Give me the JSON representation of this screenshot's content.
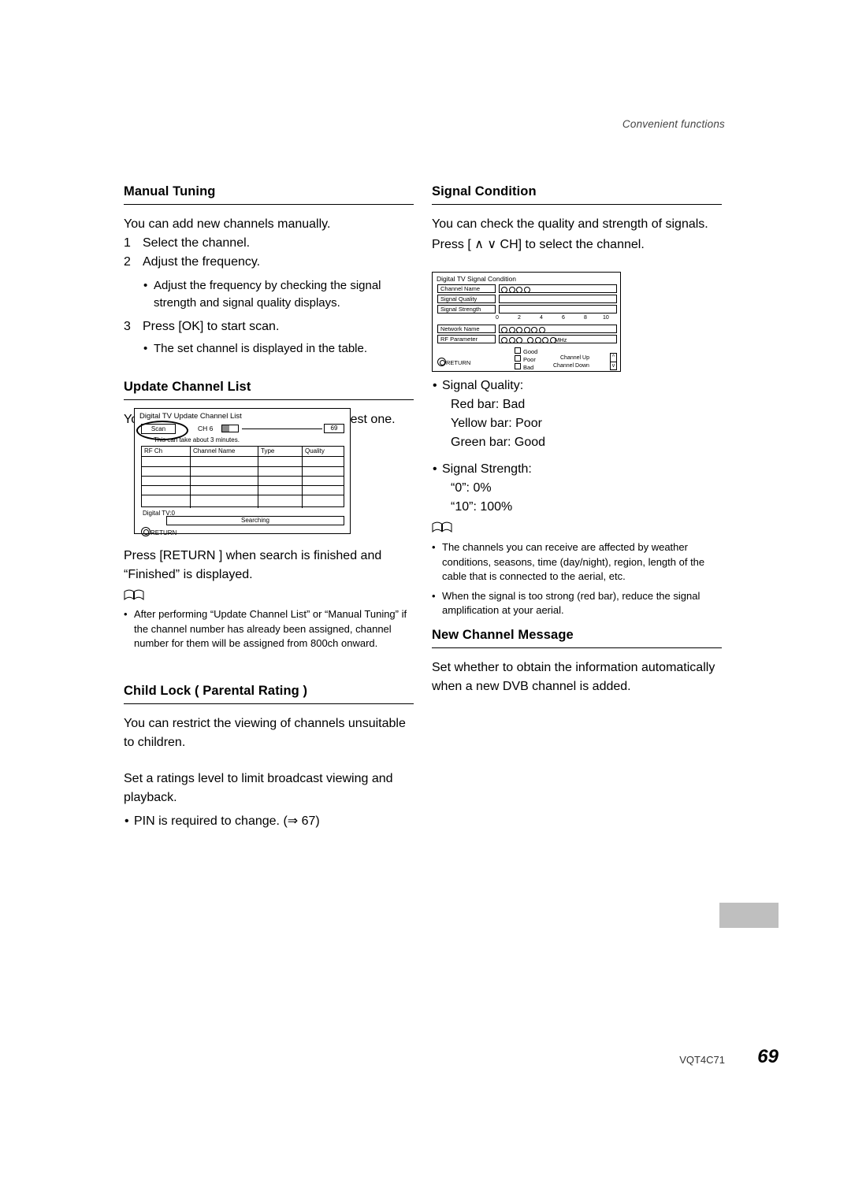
{
  "header": {
    "running_head": "Convenient functions"
  },
  "left": {
    "manual_tuning": {
      "title": "Manual Tuning",
      "intro": "You can add new channels manually.",
      "steps": [
        {
          "num": "1",
          "text": "Select the channel."
        },
        {
          "num": "2",
          "text": "Adjust the frequency."
        },
        {
          "num": "3",
          "text": "Press [OK] to start scan."
        }
      ],
      "sub_step2": "Adjust the frequency by checking the signal strength and signal quality displays.",
      "sub_step3": "The set channel is displayed in the table."
    },
    "update_channel_list": {
      "title": "Update Channel List",
      "intro": "You can update the channel list to the latest one.",
      "after_text": "Press [RETURN ] when search is finished and “Finished” is displayed.",
      "note": "After performing “Update Channel List” or “Manual Tuning” if the channel number has already been assigned, channel number for them will be assigned from 800ch onward."
    },
    "update_panel": {
      "title": "Digital TV Update Channel List",
      "scan_label": "Scan",
      "ch_label": "CH 6",
      "count": "69",
      "takes": "This can take about 3 minutes.",
      "columns": [
        "RF Ch",
        "Channel Name",
        "Type",
        "Quality"
      ],
      "dtv_label": "Digital TV:0",
      "status": "Searching",
      "return_label": "RETURN"
    },
    "child_lock": {
      "title": "Child Lock ( Parental Rating )",
      "p1": "You can restrict the viewing of channels unsuitable to children.",
      "p2": "Set a ratings level to limit broadcast viewing and playback.",
      "bullet": "PIN is required to change. (⇒ 67)"
    }
  },
  "right": {
    "signal_condition": {
      "title": "Signal Condition",
      "intro": "You can check the quality and strength of signals.",
      "press": "Press [ ∧  ∨  CH] to select the channel.",
      "quality_head": "Signal Quality:",
      "quality_lines": [
        "Red bar: Bad",
        "Yellow bar: Poor",
        "Green bar: Good"
      ],
      "strength_head": "Signal Strength:",
      "strength_lines": [
        "“0”: 0%",
        "“10”: 100%"
      ],
      "notes": [
        "The channels you can receive are affected by weather conditions, seasons, time (day/night), region, length of the cable that is connected to the aerial, etc.",
        "When the signal is too strong (red bar), reduce the signal amplification at your aerial."
      ]
    },
    "signal_panel": {
      "title": "Digital TV Signal Condition",
      "rows": [
        "Channel Name",
        "Signal Quality",
        "Signal Strength",
        "Network Name",
        "RF Parameter"
      ],
      "ticks": [
        "0",
        "2",
        "4",
        "6",
        "8",
        "10"
      ],
      "mhz": "MHz",
      "legend": [
        "Good",
        "Poor",
        "Bad"
      ],
      "channel_up": "Channel Up",
      "channel_down": "Channel Down",
      "return_label": "RETURN"
    },
    "new_channel_message": {
      "title": "New Channel Message",
      "body": "Set whether to obtain the information automatically when a new DVB channel is added."
    }
  },
  "footer": {
    "code": "VQT4C71",
    "page": "69"
  }
}
